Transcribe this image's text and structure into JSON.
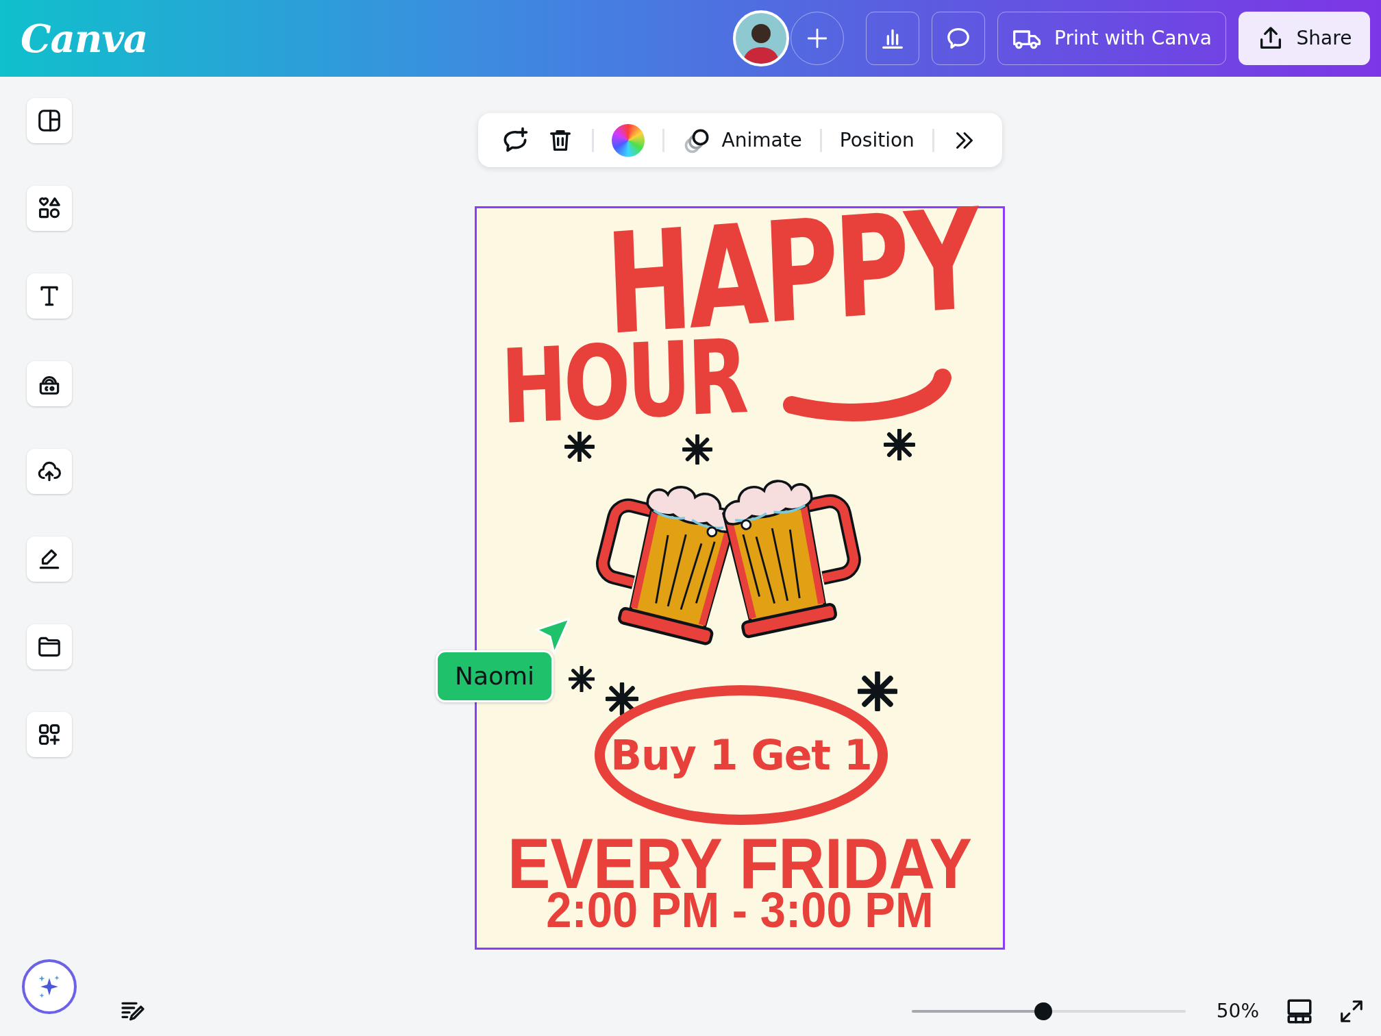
{
  "header": {
    "logo": "Canva",
    "print_label": "Print with Canva",
    "share_label": "Share"
  },
  "toolbar": {
    "animate_label": "Animate",
    "position_label": "Position"
  },
  "poster": {
    "selected": true,
    "title_line_1": "HAPPY",
    "title_line_2": "HOUR",
    "offer": "Buy 1 Get 1",
    "day": "EVERY FRIDAY",
    "time": "2:00 PM - 3:00 PM"
  },
  "collaborator_cursor": {
    "name": "Naomi"
  },
  "zoom": {
    "level": 0.48,
    "reading": "50%"
  }
}
